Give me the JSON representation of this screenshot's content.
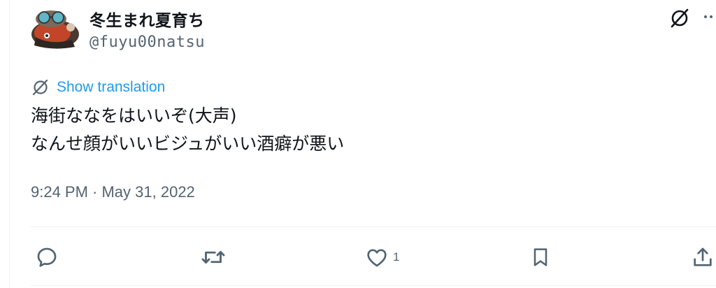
{
  "author": {
    "display_name": "冬生まれ夏育ち",
    "handle": "@fuyu00natsu"
  },
  "translate": {
    "label": "Show translation"
  },
  "tweet": {
    "lines": [
      "海街ななをはいいぞ(大声)",
      "なんせ顔がいいビジュがいい酒癖が悪い"
    ],
    "timestamp": "9:24 PM · May 31, 2022"
  },
  "actions": {
    "like_count": "1"
  },
  "icons": {
    "grok": "grok-icon",
    "more": "more-icon",
    "translate": "translate-icon",
    "reply": "reply-icon",
    "repost": "repost-icon",
    "like": "like-icon",
    "bookmark": "bookmark-icon",
    "share": "share-icon"
  },
  "colors": {
    "accent": "#1d9bf0",
    "secondary_text": "#536471",
    "primary_text": "#0f1419",
    "divider": "#eff3f4"
  }
}
